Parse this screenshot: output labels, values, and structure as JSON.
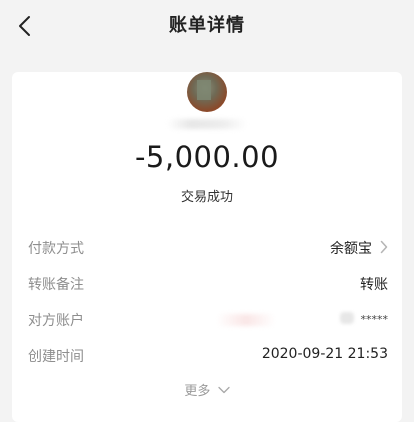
{
  "header": {
    "title": "账单详情",
    "back_icon": "chevron-left-icon"
  },
  "transaction": {
    "amount": "-5,000.00",
    "status": "交易成功"
  },
  "details": [
    {
      "label": "付款方式",
      "value": "余额宝",
      "has_chevron": true
    },
    {
      "label": "转账备注",
      "value": "转账"
    },
    {
      "label": "对方账户",
      "value": "*****"
    },
    {
      "label": "创建时间",
      "value": "2020-09-21 21:53"
    }
  ],
  "more": {
    "label": "更多",
    "icon": "chevron-down-icon"
  }
}
